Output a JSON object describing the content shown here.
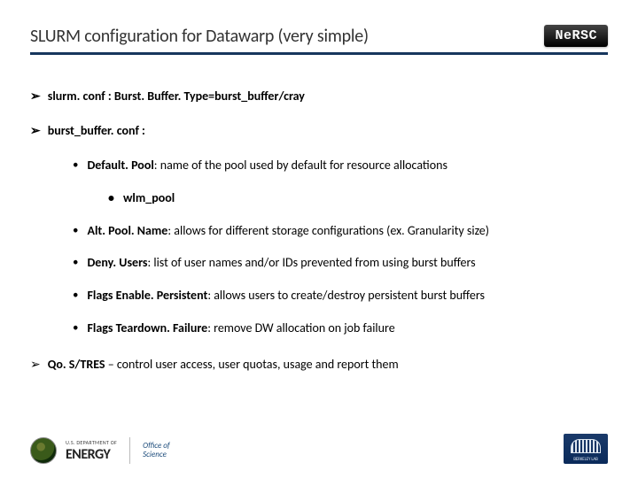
{
  "title": "SLURM configuration for Datawarp (very simple)",
  "brand_badge": "NeRSC",
  "bullets": {
    "b1": "slurm. conf : Burst. Buffer. Type=burst_buffer/cray",
    "b2": "burst_buffer. conf :",
    "sub": {
      "s1_term": "Default. Pool",
      "s1_rest": ": name of the pool used by default for resource allocations",
      "s1_sub": "wlm_pool",
      "s2_term": "Alt. Pool. Name",
      "s2_rest": ": allows for different storage configurations (ex. Granularity size)",
      "s3_term": "Deny. Users",
      "s3_rest": ": list of user names and/or IDs prevented from using burst buffers",
      "s4_term": "Flags Enable. Persistent",
      "s4_rest": ": allows users to create/destroy persistent burst buffers",
      "s5_term": "Flags Teardown. Failure",
      "s5_rest": ": remove DW allocation on job failure"
    },
    "b3_term": "Qo. S/TRES",
    "b3_rest": " – control user access, user quotas, usage and report them"
  },
  "footer": {
    "dept_small": "U.S. DEPARTMENT OF",
    "dept_big": "ENERGY",
    "office_l1": "Office of",
    "office_l2": "Science",
    "lab": "BERKELEY LAB"
  }
}
